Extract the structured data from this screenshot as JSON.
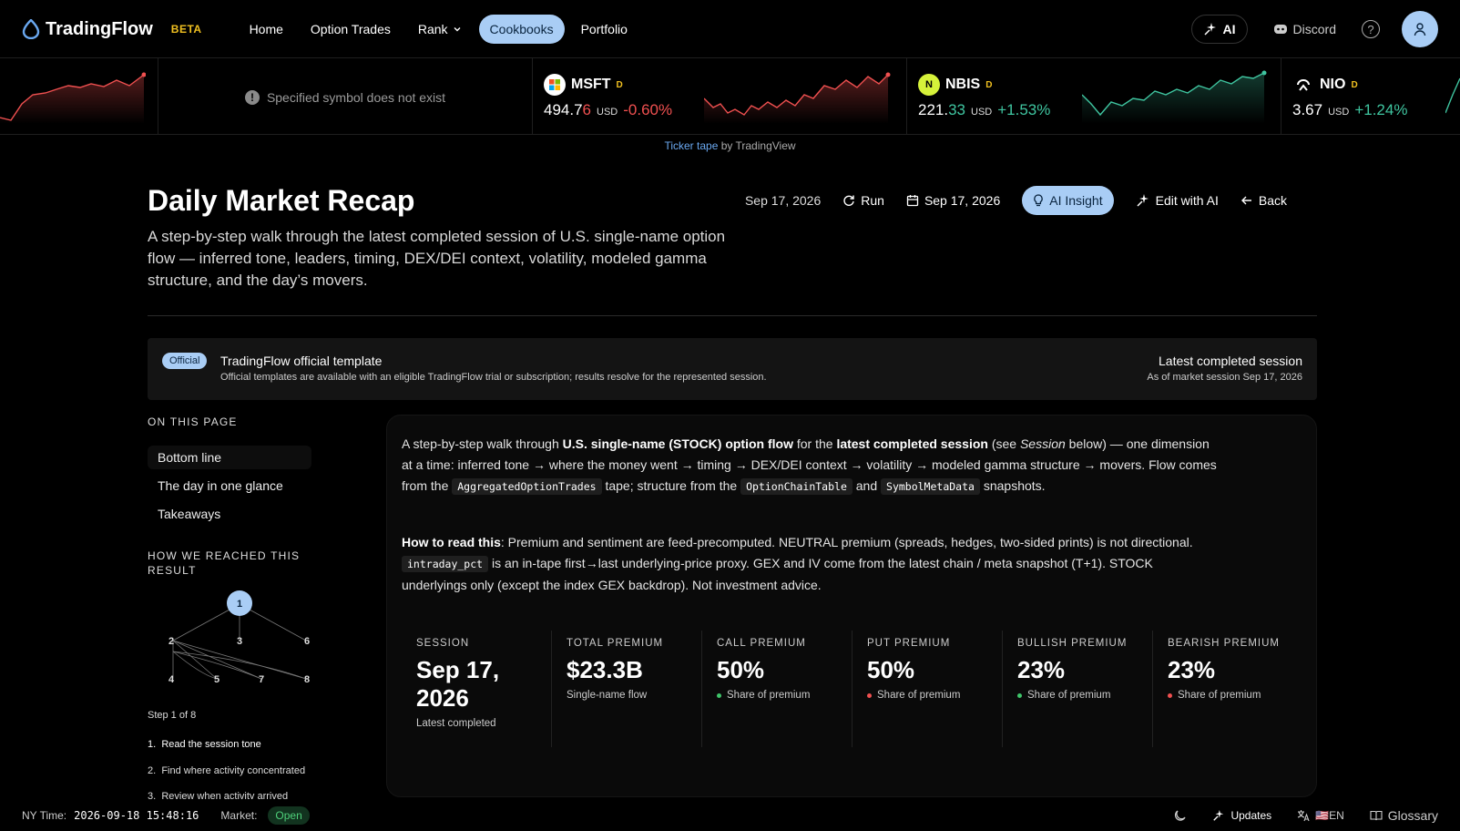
{
  "brand": {
    "name": "TradingFlow",
    "beta": "BETA"
  },
  "nav": {
    "items": [
      {
        "label": "Home"
      },
      {
        "label": "Option Trades"
      },
      {
        "label": "Rank"
      },
      {
        "label": "Cookbooks"
      },
      {
        "label": "Portfolio"
      }
    ],
    "ai_label": "AI",
    "discord_label": "Discord"
  },
  "ticker": {
    "error_text": "Specified symbol does not exist",
    "items": [
      {
        "symbol": "MSFT",
        "flag": "D",
        "price_main": "494.7",
        "price_tail": "6",
        "currency": "USD",
        "change": "-0.60%"
      },
      {
        "symbol": "NBIS",
        "flag": "D",
        "price_main": "221.",
        "price_tail": "33",
        "currency": "USD",
        "change": "+1.53%"
      },
      {
        "symbol": "NIO",
        "flag": "D",
        "price_main": "3.67",
        "price_tail": "",
        "currency": "USD",
        "change": "+1.24%"
      }
    ],
    "credit_link": "Ticker tape",
    "credit_rest": " by TradingView",
    "colors": {
      "down": "#f05050",
      "up": "#3fc5a0"
    }
  },
  "page": {
    "title": "Daily Market Recap",
    "subtitle": "A step-by-step walk through the latest completed session of U.S. single-name option flow — inferred tone, leaders, timing, DEX/DEI context, volatility, modeled gamma structure, and the day’s movers."
  },
  "actions": {
    "date_plain": "Sep 17, 2026",
    "run": "Run",
    "date_picker": "Sep 17, 2026",
    "ai_insight": "AI Insight",
    "edit_ai": "Edit with AI",
    "back": "Back"
  },
  "official": {
    "badge": "Official",
    "title": "TradingFlow official template",
    "subtitle": "Official templates are available with an eligible TradingFlow trial or subscription; results resolve for the represented session.",
    "right_title": "Latest completed session",
    "right_sub": "As of market session Sep 17, 2026"
  },
  "sidebar": {
    "on_this_page": "ON THIS PAGE",
    "toc": [
      "Bottom line",
      "The day in one glance",
      "Takeaways"
    ],
    "how_reached": "HOW WE REACHED THIS RESULT",
    "graph_nodes": [
      "1",
      "2",
      "3",
      "6",
      "4",
      "5",
      "7",
      "8"
    ],
    "step_count": "Step 1 of 8",
    "steps": [
      {
        "n": "1.",
        "label": "Read the session tone"
      },
      {
        "n": "2.",
        "label": "Find where activity concentrated"
      },
      {
        "n": "3.",
        "label": "Review when activity arrived"
      }
    ]
  },
  "card": {
    "p1": {
      "a": "A step-by-step walk through ",
      "b": "U.S. single-name (STOCK) option flow",
      "c": " for the ",
      "d": "latest completed session",
      "e": " (see ",
      "f": "Session",
      "g": " below) — one dimension at a time: inferred tone → where the money went → timing → DEX/DEI context → volatility → modeled gamma structure → movers. Flow comes from the ",
      "code1": "AggregatedOptionTrades",
      "h": " tape; structure from the ",
      "code2": "OptionChainTable",
      "i": " and ",
      "code3": "SymbolMetaData",
      "j": " snapshots."
    },
    "p2": {
      "a": "How to read this",
      "b": ": Premium and sentiment are feed-precomputed. NEUTRAL premium (spreads, hedges, two-sided prints) is not directional. ",
      "code1": "intraday_pct",
      "c": " is an in-tape first→last underlying-price proxy. GEX and IV come from the latest chain / meta snapshot (T+1). STOCK underlyings only (except the index GEX backdrop). Not investment advice."
    },
    "stats": [
      {
        "label": "SESSION",
        "value": "Sep 17, 2026",
        "note": "Latest completed",
        "dot": ""
      },
      {
        "label": "TOTAL PREMIUM",
        "value": "$23.3B",
        "note": "Single-name flow",
        "dot": ""
      },
      {
        "label": "CALL PREMIUM",
        "value": "50%",
        "note": "Share of premium",
        "dot": "#3fc56a"
      },
      {
        "label": "PUT PREMIUM",
        "value": "50%",
        "note": "Share of premium",
        "dot": "#f05050"
      },
      {
        "label": "BULLISH PREMIUM",
        "value": "23%",
        "note": "Share of premium",
        "dot": "#3fc56a"
      },
      {
        "label": "BEARISH PREMIUM",
        "value": "23%",
        "note": "Share of premium",
        "dot": "#f05050"
      }
    ]
  },
  "bottombar": {
    "ny_label": "NY Time:",
    "ny_time": "2026-09-18 15:48:16",
    "market_label": "Market:",
    "market_status": "Open",
    "updates": "Updates",
    "lang": "🇺🇸EN",
    "glossary": "Glossary"
  },
  "colors": {
    "accent": "#a9cdf5",
    "beta": "#f0c020"
  }
}
